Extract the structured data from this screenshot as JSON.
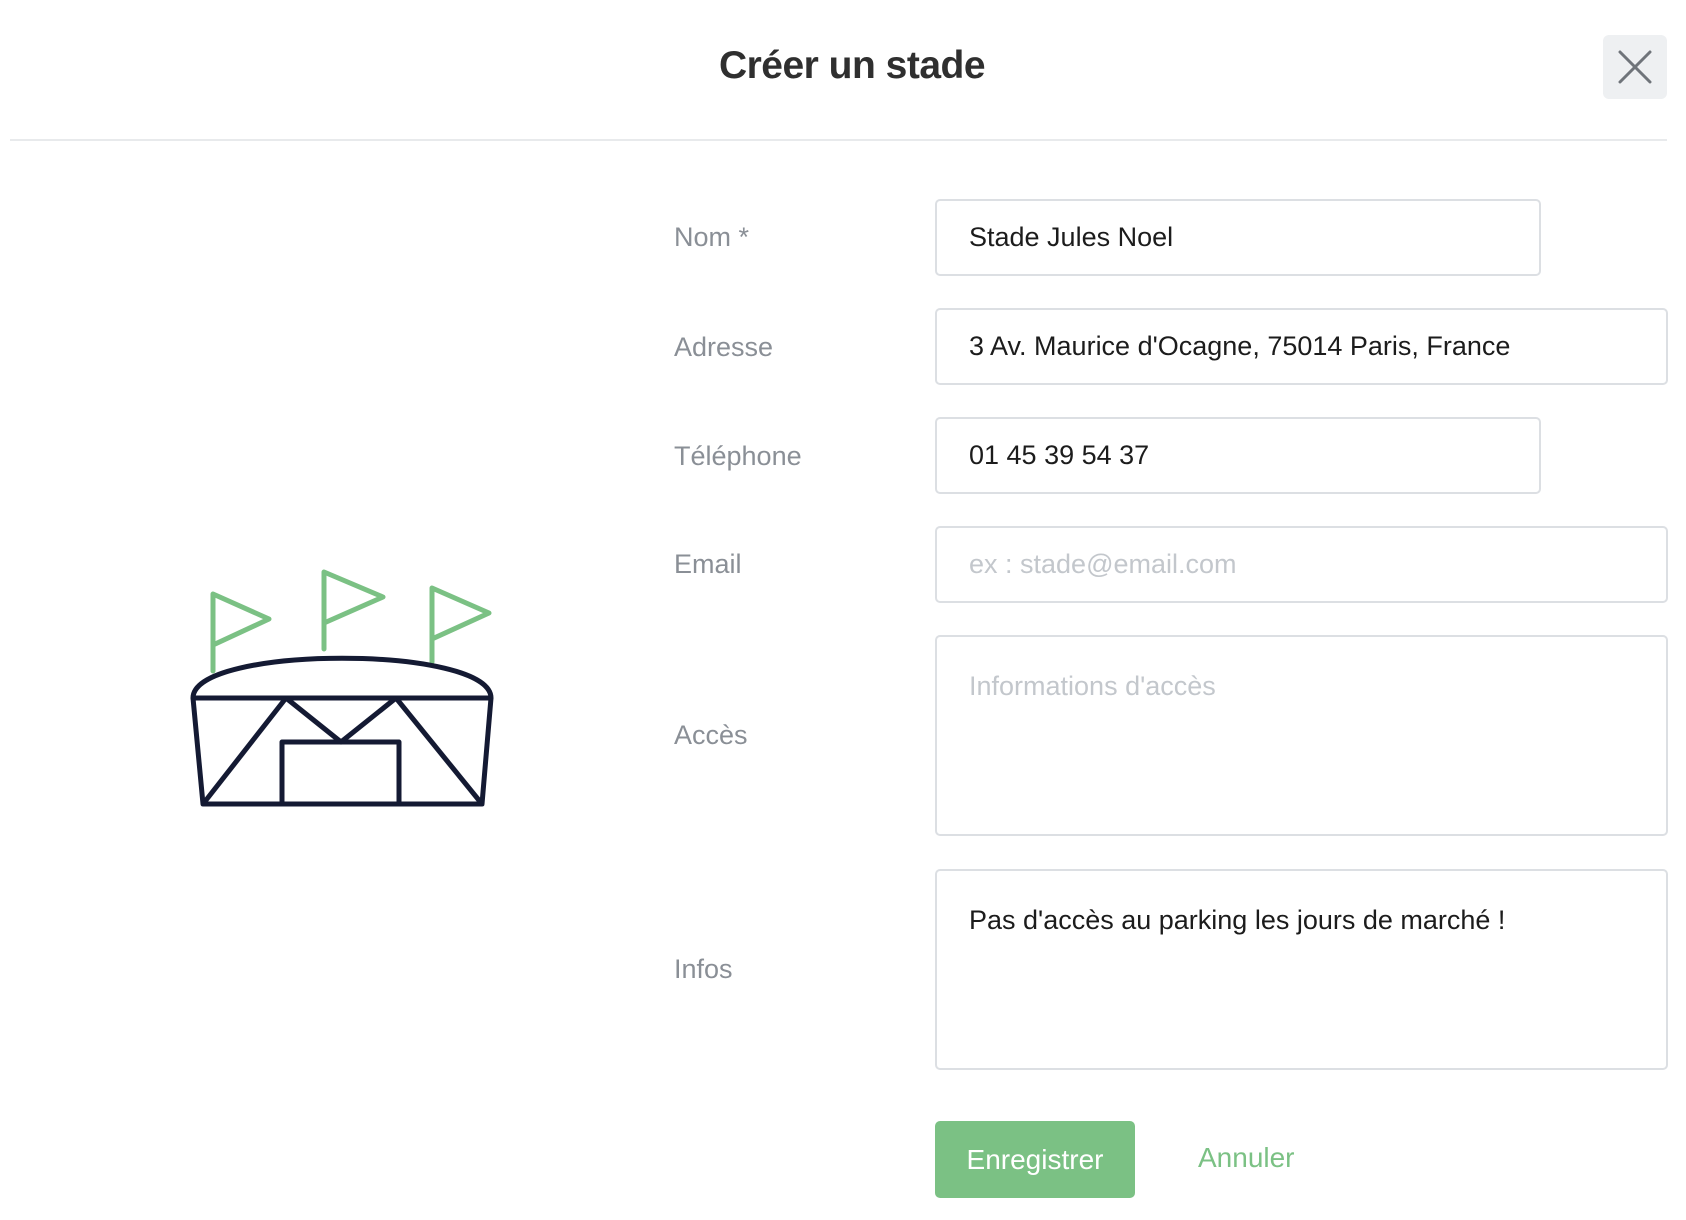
{
  "dialog": {
    "title": "Créer un stade",
    "close_icon": "close-icon"
  },
  "illustration": {
    "icon": "stadium-icon",
    "colors": {
      "flags": "#7bc184",
      "stadium": "#141a33"
    }
  },
  "form": {
    "nom": {
      "label": "Nom *",
      "value": "Stade Jules Noel"
    },
    "adresse": {
      "label": "Adresse",
      "value": "3 Av. Maurice d'Ocagne, 75014 Paris, France"
    },
    "telephone": {
      "label": "Téléphone",
      "value": "01 45 39 54 37"
    },
    "email": {
      "label": "Email",
      "placeholder": "ex : stade@email.com"
    },
    "acces": {
      "label": "Accès",
      "placeholder": "Informations d'accès"
    },
    "infos": {
      "label": "Infos",
      "value": "Pas d'accès au parking les jours de marché !"
    }
  },
  "actions": {
    "save_label": "Enregistrer",
    "cancel_label": "Annuler"
  },
  "colors": {
    "accent": "#7bc184",
    "border": "#dcdfe3",
    "label": "#8a8f96"
  }
}
